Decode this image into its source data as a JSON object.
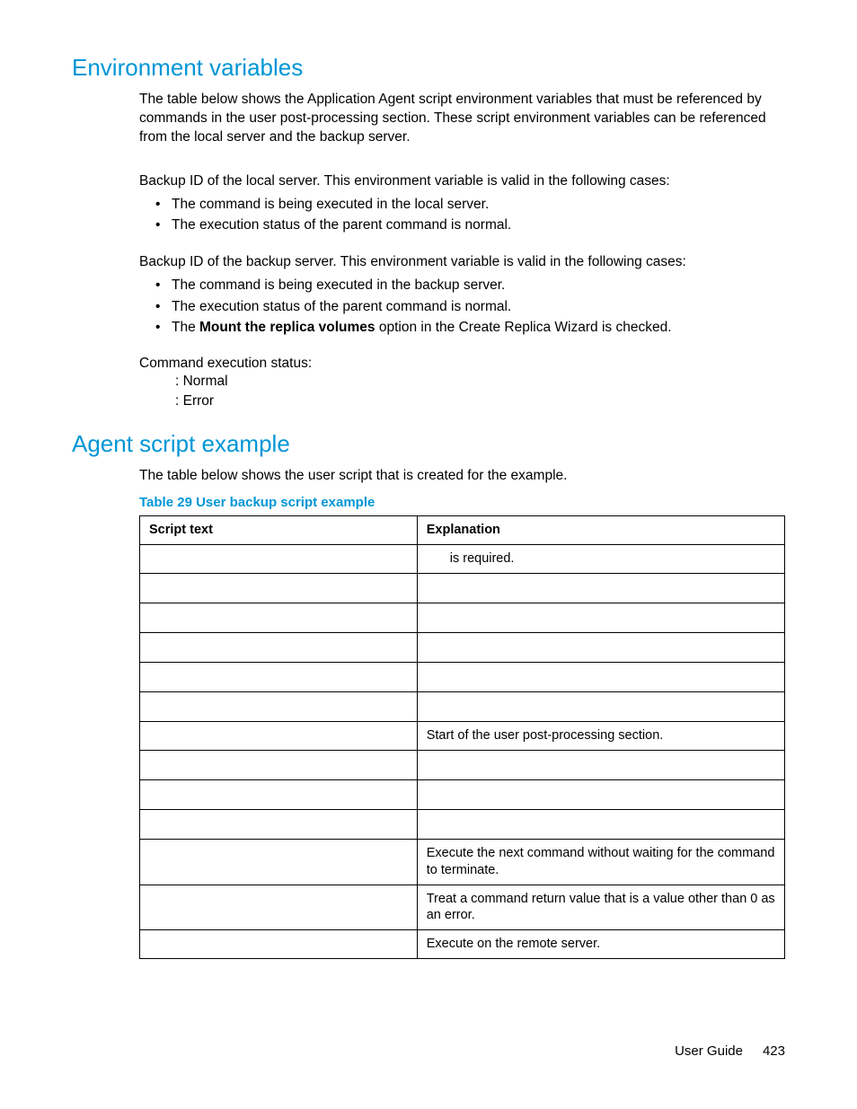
{
  "sections": {
    "env": {
      "heading": "Environment variables",
      "intro": "The table below shows the Application Agent script environment variables that must be referenced by commands in the user post-processing section. These script environment variables can be referenced from the local server and the backup server.",
      "local_lead": "Backup ID of the local server. This environment variable is valid in the following cases:",
      "local_bullets": [
        "The command is being executed in the local server.",
        "The execution status of the parent command is normal."
      ],
      "backup_lead": "Backup ID of the backup server. This environment variable is valid in the following cases:",
      "backup_bullets_pre": [
        "The command is being executed in the backup server.",
        "The execution status of the parent command is normal."
      ],
      "backup_bullet3_pre": "The ",
      "backup_bullet3_bold": "Mount the replica volumes",
      "backup_bullet3_post": " option in the Create Replica Wizard is checked.",
      "status_label": "Command execution status:",
      "status_normal": ": Normal",
      "status_error": ": Error"
    },
    "example": {
      "heading": "Agent script example",
      "intro": "The table below shows the user script that is created for the example.",
      "caption": "Table 29 User backup script example",
      "headers": {
        "col1": "Script text",
        "col2": "Explanation"
      },
      "rows": [
        {
          "script": "",
          "expl_pad": " is required."
        },
        {
          "script": "",
          "expl": ""
        },
        {
          "script": "",
          "expl": ""
        },
        {
          "script": "",
          "expl": ""
        },
        {
          "script": "",
          "expl": ""
        },
        {
          "script": "",
          "expl": ""
        },
        {
          "script": "",
          "expl": "Start of the user post-processing section."
        },
        {
          "script": "",
          "expl": ""
        },
        {
          "script": "",
          "expl": ""
        },
        {
          "script": "",
          "expl": ""
        },
        {
          "script": "",
          "expl": "Execute the next command without waiting for the command to terminate."
        },
        {
          "script": "",
          "expl": "Treat a command return value that is a value other than 0 as an error."
        },
        {
          "script": "",
          "expl": "Execute on the remote server."
        }
      ]
    }
  },
  "footer": {
    "label": "User Guide",
    "page": "423"
  }
}
